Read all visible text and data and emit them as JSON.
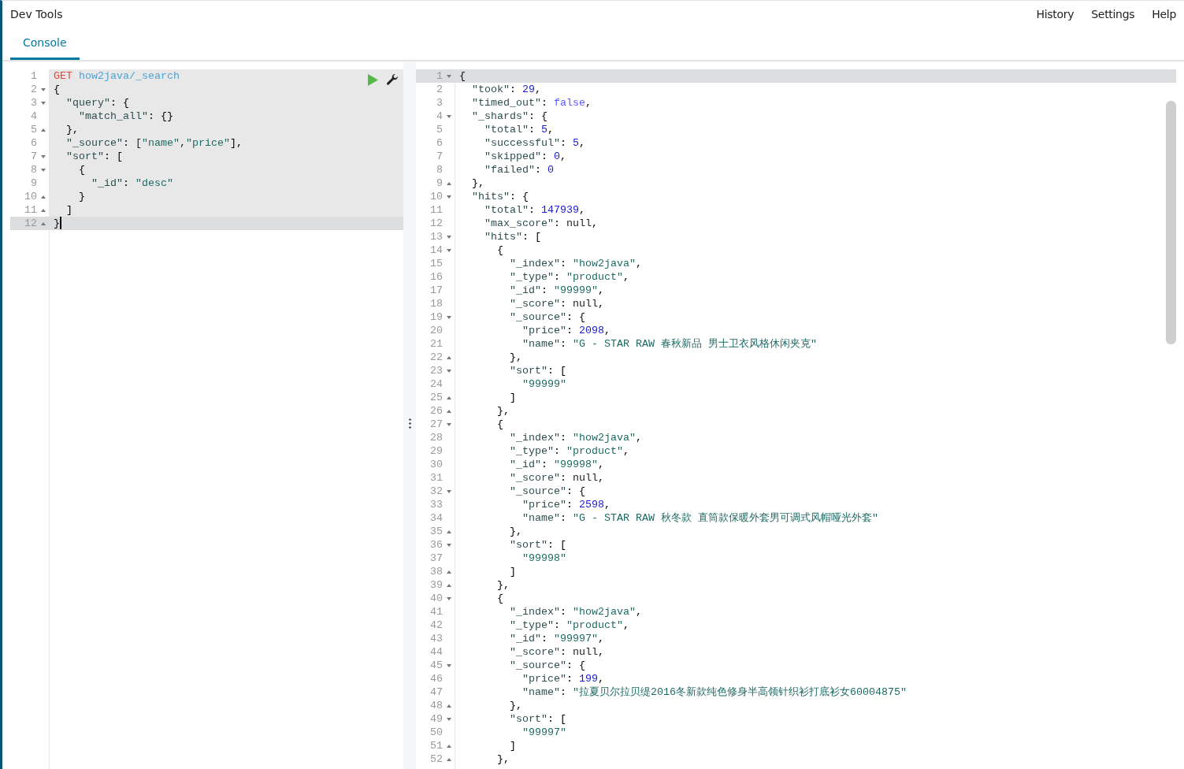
{
  "header": {
    "title": "Dev Tools",
    "nav": [
      "History",
      "Settings",
      "Help"
    ]
  },
  "tabs": [
    {
      "label": "Console",
      "selected": true
    }
  ],
  "request_editor": {
    "kind": "request",
    "lines": [
      {
        "number": "1",
        "kind": "request",
        "text": "GET how2java/_search",
        "active": false
      },
      {
        "number": "2",
        "kind": "code",
        "text": "{",
        "fold_start": true,
        "active": false
      },
      {
        "number": "3",
        "kind": "code",
        "text": "  \"query\": {",
        "fold_start": true,
        "active": false
      },
      {
        "number": "4",
        "kind": "code",
        "text": "    \"match_all\": {}",
        "active": false
      },
      {
        "number": "5",
        "kind": "code",
        "text": "  },",
        "fold_end": true,
        "active": false
      },
      {
        "number": "6",
        "kind": "code",
        "text": "  \"_source\": [\"name\",\"price\"],",
        "active": false
      },
      {
        "number": "7",
        "kind": "code",
        "text": "  \"sort\": [",
        "fold_start": true,
        "active": false
      },
      {
        "number": "8",
        "kind": "code",
        "text": "    {",
        "fold_start": true,
        "active": false
      },
      {
        "number": "9",
        "kind": "code",
        "text": "      \"_id\": \"desc\"",
        "active": false
      },
      {
        "number": "10",
        "kind": "code",
        "text": "    }",
        "fold_end": true,
        "active": false
      },
      {
        "number": "11",
        "kind": "code",
        "text": "  ]",
        "fold_end": true,
        "active": false
      },
      {
        "number": "12",
        "kind": "code",
        "text": "}",
        "fold_end": true,
        "active": true
      }
    ]
  },
  "response_editor": {
    "kind": "response",
    "lines": [
      {
        "number": "1",
        "text": "{",
        "fold_start": true,
        "active": true
      },
      {
        "number": "2",
        "text": "  \"took\": 29,",
        "active": false
      },
      {
        "number": "3",
        "text": "  \"timed_out\": false,",
        "active": false
      },
      {
        "number": "4",
        "text": "  \"_shards\": {",
        "fold_start": true,
        "active": false
      },
      {
        "number": "5",
        "text": "    \"total\": 5,",
        "active": false
      },
      {
        "number": "6",
        "text": "    \"successful\": 5,",
        "active": false
      },
      {
        "number": "7",
        "text": "    \"skipped\": 0,",
        "active": false
      },
      {
        "number": "8",
        "text": "    \"failed\": 0",
        "active": false
      },
      {
        "number": "9",
        "text": "  },",
        "fold_end": true,
        "active": false
      },
      {
        "number": "10",
        "text": "  \"hits\": {",
        "fold_start": true,
        "active": false
      },
      {
        "number": "11",
        "text": "    \"total\": 147939,",
        "active": false
      },
      {
        "number": "12",
        "text": "    \"max_score\": null,",
        "active": false
      },
      {
        "number": "13",
        "text": "    \"hits\": [",
        "fold_start": true,
        "active": false
      },
      {
        "number": "14",
        "text": "      {",
        "fold_start": true,
        "active": false
      },
      {
        "number": "15",
        "text": "        \"_index\": \"how2java\",",
        "active": false
      },
      {
        "number": "16",
        "text": "        \"_type\": \"product\",",
        "active": false
      },
      {
        "number": "17",
        "text": "        \"_id\": \"99999\",",
        "active": false
      },
      {
        "number": "18",
        "text": "        \"_score\": null,",
        "active": false
      },
      {
        "number": "19",
        "text": "        \"_source\": {",
        "fold_start": true,
        "active": false
      },
      {
        "number": "20",
        "text": "          \"price\": 2098,",
        "active": false
      },
      {
        "number": "21",
        "text": "          \"name\": \"G - STAR RAW 春秋新品 男士卫衣风格休闲夹克\"",
        "active": false
      },
      {
        "number": "22",
        "text": "        },",
        "fold_end": true,
        "active": false
      },
      {
        "number": "23",
        "text": "        \"sort\": [",
        "fold_start": true,
        "active": false
      },
      {
        "number": "24",
        "text": "          \"99999\"",
        "active": false
      },
      {
        "number": "25",
        "text": "        ]",
        "fold_end": true,
        "active": false
      },
      {
        "number": "26",
        "text": "      },",
        "fold_end": true,
        "active": false
      },
      {
        "number": "27",
        "text": "      {",
        "fold_start": true,
        "active": false
      },
      {
        "number": "28",
        "text": "        \"_index\": \"how2java\",",
        "active": false
      },
      {
        "number": "29",
        "text": "        \"_type\": \"product\",",
        "active": false
      },
      {
        "number": "30",
        "text": "        \"_id\": \"99998\",",
        "active": false
      },
      {
        "number": "31",
        "text": "        \"_score\": null,",
        "active": false
      },
      {
        "number": "32",
        "text": "        \"_source\": {",
        "fold_start": true,
        "active": false
      },
      {
        "number": "33",
        "text": "          \"price\": 2598,",
        "active": false
      },
      {
        "number": "34",
        "text": "          \"name\": \"G - STAR RAW 秋冬款 直筒款保暖外套男可调式风帽哑光外套\"",
        "active": false
      },
      {
        "number": "35",
        "text": "        },",
        "fold_end": true,
        "active": false
      },
      {
        "number": "36",
        "text": "        \"sort\": [",
        "fold_start": true,
        "active": false
      },
      {
        "number": "37",
        "text": "          \"99998\"",
        "active": false
      },
      {
        "number": "38",
        "text": "        ]",
        "fold_end": true,
        "active": false
      },
      {
        "number": "39",
        "text": "      },",
        "fold_end": true,
        "active": false
      },
      {
        "number": "40",
        "text": "      {",
        "fold_start": true,
        "active": false
      },
      {
        "number": "41",
        "text": "        \"_index\": \"how2java\",",
        "active": false
      },
      {
        "number": "42",
        "text": "        \"_type\": \"product\",",
        "active": false
      },
      {
        "number": "43",
        "text": "        \"_id\": \"99997\",",
        "active": false
      },
      {
        "number": "44",
        "text": "        \"_score\": null,",
        "active": false
      },
      {
        "number": "45",
        "text": "        \"_source\": {",
        "fold_start": true,
        "active": false
      },
      {
        "number": "46",
        "text": "          \"price\": 199,",
        "active": false
      },
      {
        "number": "47",
        "text": "          \"name\": \"拉夏贝尔拉贝缇2016冬新款纯色修身半高领针织衫打底衫女60004875\"",
        "active": false
      },
      {
        "number": "48",
        "text": "        },",
        "fold_end": true,
        "active": false
      },
      {
        "number": "49",
        "text": "        \"sort\": [",
        "fold_start": true,
        "active": false
      },
      {
        "number": "50",
        "text": "          \"99997\"",
        "active": false
      },
      {
        "number": "51",
        "text": "        ]",
        "fold_end": true,
        "active": false
      },
      {
        "number": "52",
        "text": "      },",
        "fold_end": true,
        "active": false
      }
    ]
  }
}
